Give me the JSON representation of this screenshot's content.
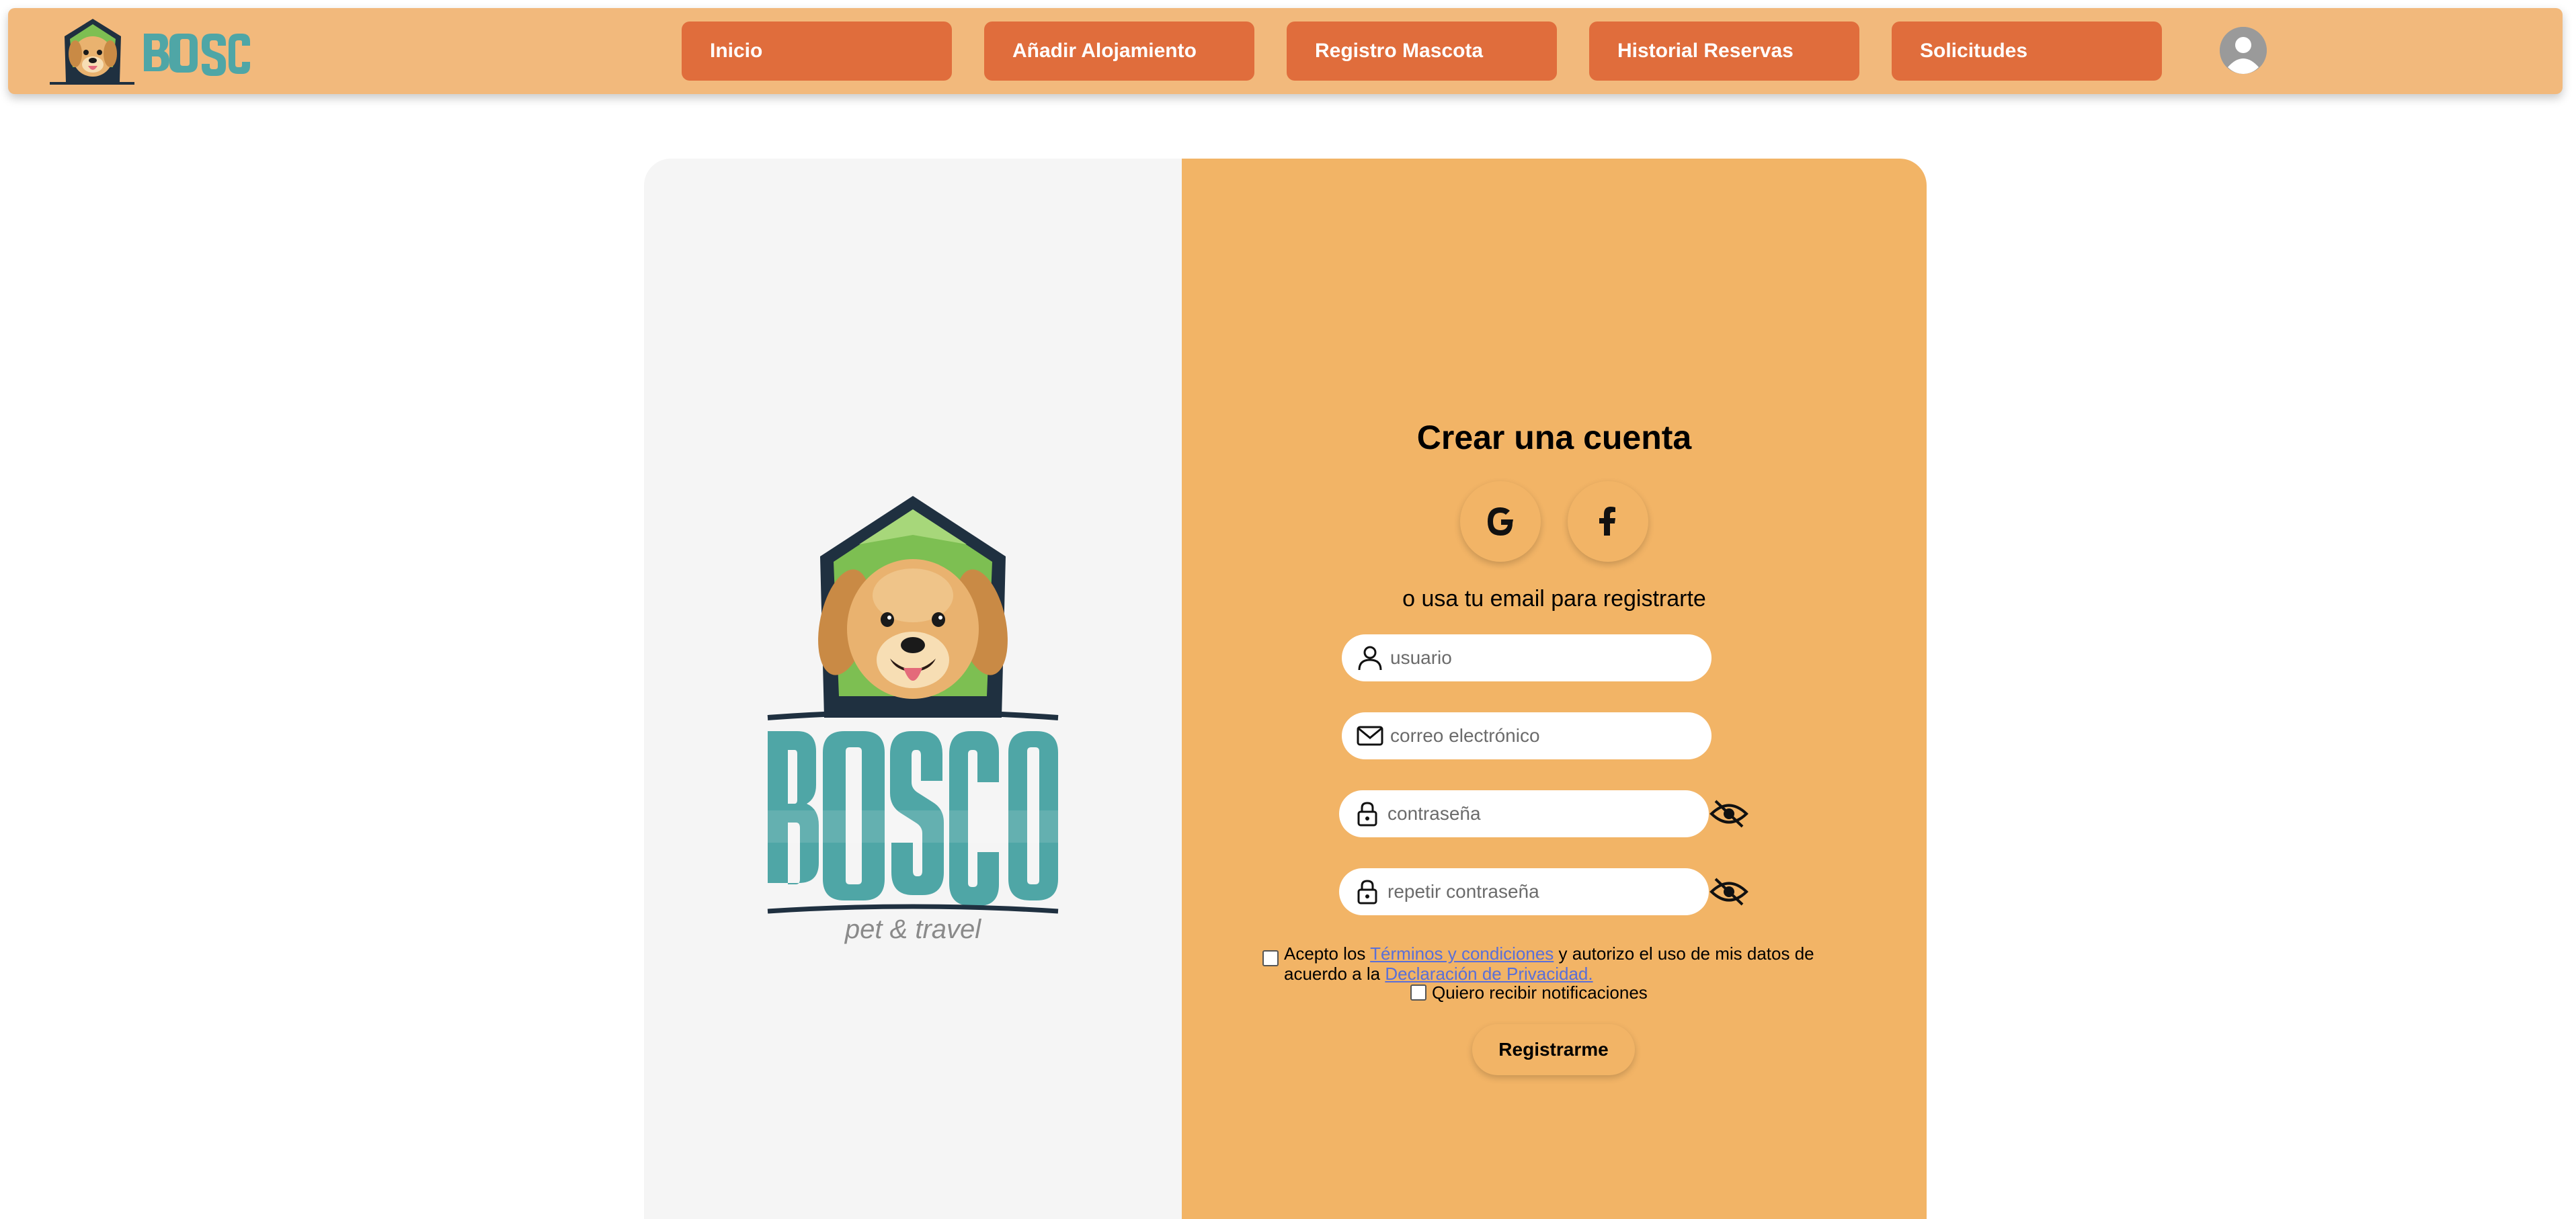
{
  "brand": {
    "logo_name": "BOSCO",
    "logo_tagline": "pet & travel"
  },
  "nav": {
    "items": [
      {
        "label": "Inicio"
      },
      {
        "label": "Añadir Alojamiento"
      },
      {
        "label": "Registro Mascota"
      },
      {
        "label": "Historial Reservas"
      },
      {
        "label": "Solicitudes"
      }
    ]
  },
  "form": {
    "title": "Crear una cuenta",
    "social": [
      {
        "icon": "google-icon"
      },
      {
        "icon": "facebook-icon"
      }
    ],
    "or_text": "o usa tu email para registrarte",
    "fields": {
      "username": {
        "placeholder": "usuario",
        "icon": "user-icon"
      },
      "email": {
        "placeholder": "correo electrónico",
        "icon": "mail-icon"
      },
      "password": {
        "placeholder": "contraseña",
        "icon": "lock-icon"
      },
      "password_repeat": {
        "placeholder": "repetir contraseña",
        "icon": "lock-icon"
      }
    },
    "terms": {
      "prefix": "Acepto los ",
      "terms_link": "Términos y condiciones",
      "middle": " y autorizo el uso de mis datos de acuerdo a la ",
      "privacy_link": "Declaración de Privacidad."
    },
    "notifications_label": "Quiero recibir notificaciones",
    "submit_label": "Registrarme"
  },
  "colors": {
    "navbar_bg": "#f2b97c",
    "nav_button": "#e06d3c",
    "form_panel": "#f2b466",
    "logo_panel": "#f5f5f5",
    "link": "#5a6fd8",
    "brand_teal": "#4fa6a6"
  }
}
